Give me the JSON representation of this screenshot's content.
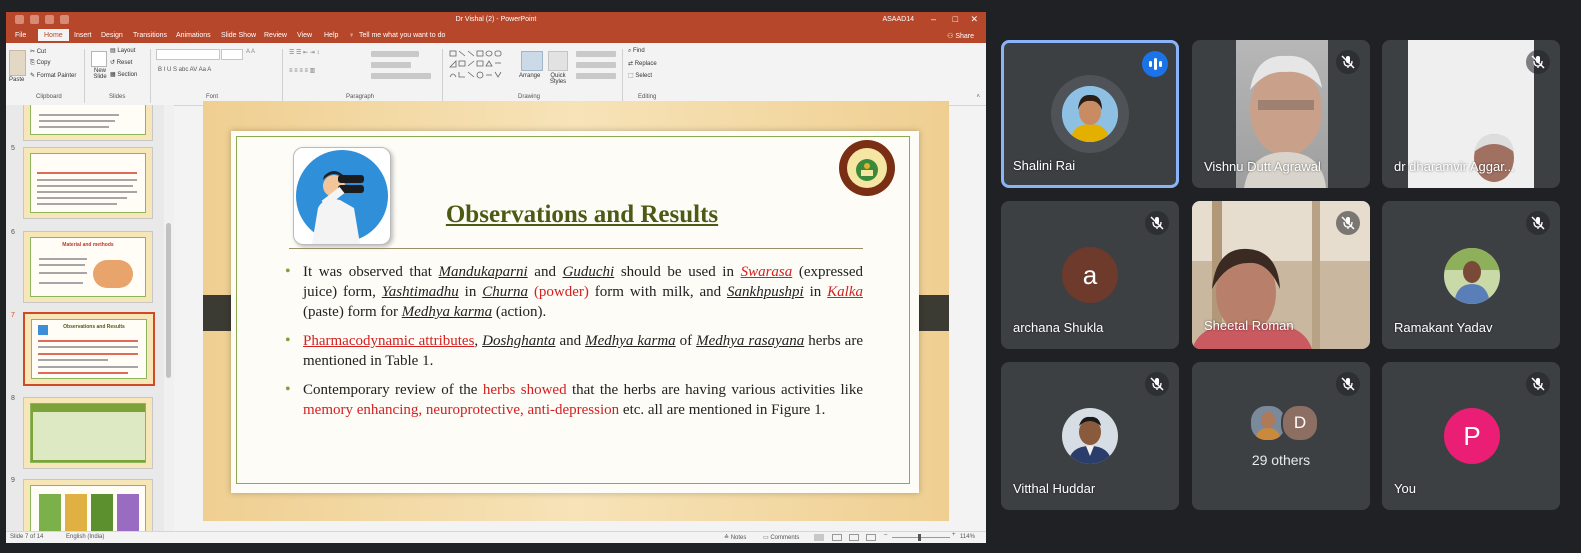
{
  "ppt": {
    "window_title": "Dr Vishal (2) - PowerPoint",
    "user": "ASAAD14",
    "menus": [
      "File",
      "Home",
      "Insert",
      "Design",
      "Transitions",
      "Animations",
      "Slide Show",
      "Review",
      "View",
      "Help"
    ],
    "tell_me": "Tell me what you want to do",
    "share": "Share",
    "ribbon": {
      "clipboard": "Clipboard",
      "paste": "Paste",
      "cut": "Cut",
      "copy": "Copy",
      "format_painter": "Format Painter",
      "slides": "Slides",
      "new_slide": "New Slide",
      "layout": "Layout",
      "reset": "Reset",
      "section": "Section",
      "font": "Font",
      "paragraph": "Paragraph",
      "drawing": "Drawing",
      "editing": "Editing",
      "arrange": "Arrange",
      "quick_styles": "Quick Styles",
      "find": "Find",
      "replace": "Replace",
      "select": "Select"
    },
    "thumbnails": [
      {
        "num": "5"
      },
      {
        "num": "6",
        "title": "Material and methods"
      },
      {
        "num": "7",
        "title": "Observations and Results"
      },
      {
        "num": "8"
      },
      {
        "num": "9"
      }
    ],
    "slide": {
      "title": "Observations and Results",
      "b1": {
        "t1": "It was observed that ",
        "t2": "Mandukaparni",
        "t3": " and ",
        "t4": "Guduchi",
        "t5": " should be used in ",
        "t6": "Swarasa",
        "t7": " (expressed juice) form, ",
        "t8": "Yashtimadhu",
        "t9": " in ",
        "t10": "Churna",
        "t11": " (powder)",
        "t12": " form with milk, and ",
        "t13": "Sankhpushpi",
        "t14": " in ",
        "t15": "Kalka",
        "t16": " (paste) form for ",
        "t17": "Medhya karma",
        "t18": " (action)."
      },
      "b2": {
        "t1": "Pharmacodynamic attributes",
        "t2": ", ",
        "t3": "Doshghanta",
        "t4": " and ",
        "t5": "Medhya karma",
        "t6": " of ",
        "t7": "Medhya rasayana",
        "t8": " herbs are mentioned in Table 1."
      },
      "b3": {
        "t1": "Contemporary review of the ",
        "t2": "herbs showed",
        "t3": " that the herbs are having various activities like ",
        "t4": "memory enhancing, neuroprotective, anti-depression",
        "t5": " etc. all are mentioned in Figure 1."
      }
    },
    "status": {
      "slide_of": "Slide 7 of 14",
      "language": "English (India)",
      "notes": "Notes",
      "comments": "Comments",
      "zoom": "114%"
    }
  },
  "meet": {
    "tiles": [
      {
        "name": "Shalini Rai",
        "speaking": true
      },
      {
        "name": "Vishnu Dutt Agrawal",
        "muted": true
      },
      {
        "name": "dr dharamvir Aggar...",
        "muted": true
      },
      {
        "name": "archana Shukla",
        "initial": "a",
        "muted": true
      },
      {
        "name": "Sheetal Roman",
        "muted": true
      },
      {
        "name": "Ramakant Yadav",
        "muted": true
      },
      {
        "name": "Vitthal Huddar",
        "muted": true
      },
      {
        "others_label": "29 others",
        "initial": "D",
        "muted": true
      },
      {
        "name": "You",
        "initial": "P",
        "muted": true
      }
    ],
    "colors": {
      "tile_bg": "#3c4043",
      "active_border": "#8ab4f8",
      "speaking": "#1a73e8",
      "you_avatar": "#ea1e74",
      "archana_avatar": "#6d3a2c"
    }
  }
}
